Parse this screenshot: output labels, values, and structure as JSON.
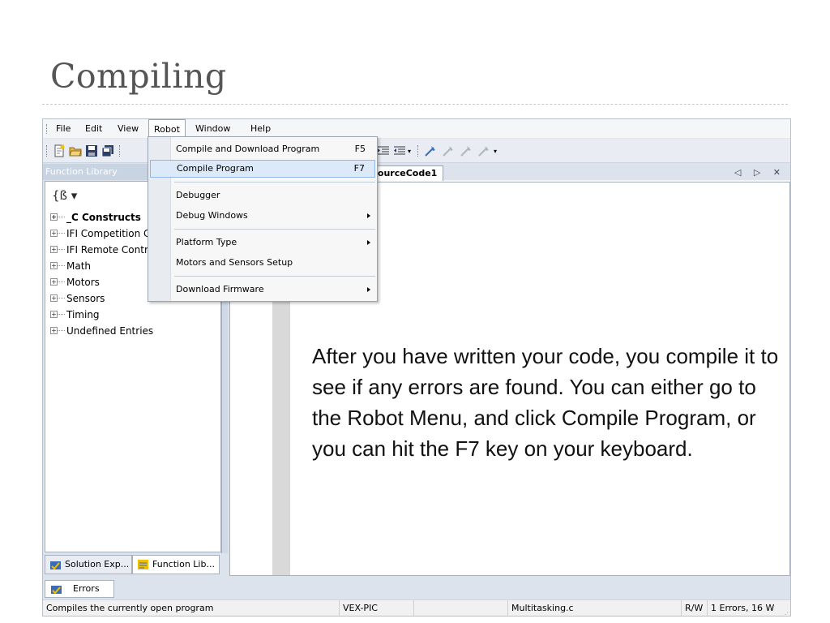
{
  "slide": {
    "title": "Compiling",
    "instructions": "After you have written your code, you compile it to see if any errors are found. You can either go to the Robot Menu, and click Compile Program, or you can hit the F7 key on your keyboard."
  },
  "menubar": {
    "items": [
      "File",
      "Edit",
      "View",
      "Robot",
      "Window",
      "Help"
    ],
    "active": "Robot"
  },
  "robot_menu": {
    "items": [
      {
        "label": "Compile and Download Program",
        "shortcut": "F5"
      },
      {
        "label": "Compile Program",
        "shortcut": "F7",
        "highlighted": true
      },
      {
        "label": "Debugger"
      },
      {
        "label": "Debug Windows",
        "submenu": true
      },
      {
        "label": "Platform Type",
        "submenu": true
      },
      {
        "label": "Motors and Sensors Setup"
      },
      {
        "label": "Download Firmware",
        "submenu": true
      }
    ]
  },
  "function_library": {
    "header": "Function Library",
    "icon_label": "{ß ▾",
    "tree": [
      {
        "label": "_C Constructs",
        "bold": true
      },
      {
        "label": "IFI Competition Control"
      },
      {
        "label": "IFI Remote Control"
      },
      {
        "label": "Math"
      },
      {
        "label": "Motors"
      },
      {
        "label": "Sensors"
      },
      {
        "label": "Timing"
      },
      {
        "label": "Undefined Entries"
      }
    ],
    "tabs": [
      "Solution Exp...",
      "Function Lib..."
    ]
  },
  "editor": {
    "tab_label": "SourceCode1",
    "controls": "◁ ▷ ✕"
  },
  "bottom_tab": "Errors",
  "statusbar": {
    "message": "Compiles the currently open program",
    "platform": "VEX-PIC",
    "file": "Multitasking.c",
    "mode": "R/W",
    "errors": "1 Errors, 16 W"
  },
  "colors": {
    "highlight": "#dbe9f9",
    "title_gray": "#555555",
    "panel_header": "#c9d4e3"
  }
}
